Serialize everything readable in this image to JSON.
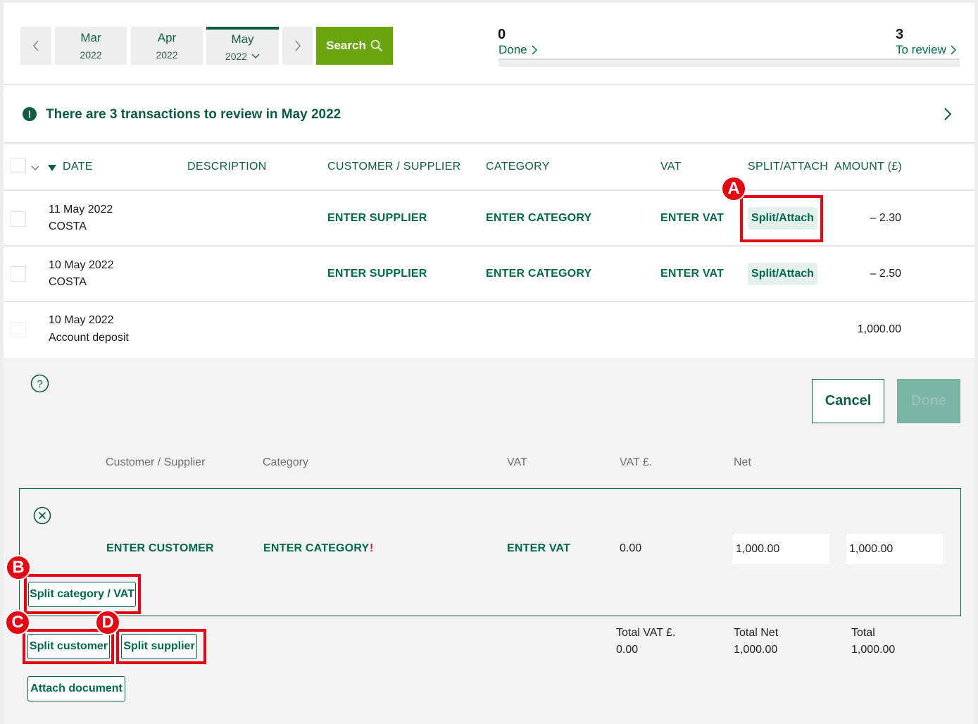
{
  "nav": {
    "months": [
      {
        "month": "Mar",
        "year": "2022"
      },
      {
        "month": "Apr",
        "year": "2022"
      },
      {
        "month": "May",
        "year": "2022",
        "active": true
      }
    ],
    "search_label": "Search",
    "done_count": "0",
    "done_label": "Done",
    "review_count": "3",
    "review_label": "To review"
  },
  "banner": {
    "text": "There are 3 transactions to review in May 2022"
  },
  "table": {
    "headers": {
      "date": "DATE",
      "description": "DESCRIPTION",
      "customer_supplier": "CUSTOMER / SUPPLIER",
      "category": "CATEGORY",
      "vat": "VAT",
      "split_attach": "SPLIT/ATTACH",
      "amount": "AMOUNT (£)"
    },
    "rows": [
      {
        "date": "11 May 2022",
        "name": "COSTA",
        "supplier": "ENTER SUPPLIER",
        "category": "ENTER CATEGORY",
        "vat": "ENTER VAT",
        "split": "Split/Attach",
        "amount": "– 2.30"
      },
      {
        "date": "10 May 2022",
        "name": "COSTA",
        "supplier": "ENTER SUPPLIER",
        "category": "ENTER CATEGORY",
        "vat": "ENTER VAT",
        "split": "Split/Attach",
        "amount": "– 2.50"
      },
      {
        "date": "10 May 2022",
        "name": "Account deposit",
        "amount": "1,000.00"
      }
    ]
  },
  "detail": {
    "cancel_label": "Cancel",
    "done_label": "Done",
    "headers": {
      "customer_supplier": "Customer / Supplier",
      "category": "Category",
      "vat": "VAT",
      "vat_amount": "VAT £.",
      "net": "Net"
    },
    "line": {
      "customer": "ENTER CUSTOMER",
      "category": "ENTER CATEGORY",
      "warning": "!",
      "vat": "ENTER VAT",
      "vat_amount": "0.00",
      "net_value": "1,000.00",
      "total_value": "1,000.00"
    },
    "buttons": {
      "split_category_vat": "Split category / VAT",
      "split_customer": "Split customer",
      "split_supplier": "Split supplier",
      "attach_document": "Attach document"
    },
    "totals": {
      "vat_label": "Total VAT £.",
      "vat_value": "0.00",
      "net_label": "Total Net",
      "net_value": "1,000.00",
      "total_label": "Total",
      "total_value": "1,000.00"
    }
  },
  "callouts": {
    "a": "A",
    "b": "B",
    "c": "C",
    "d": "D"
  },
  "colors": {
    "brand_green": "#00694b",
    "search_green": "#6aa40f",
    "callout_red": "#e30613"
  }
}
